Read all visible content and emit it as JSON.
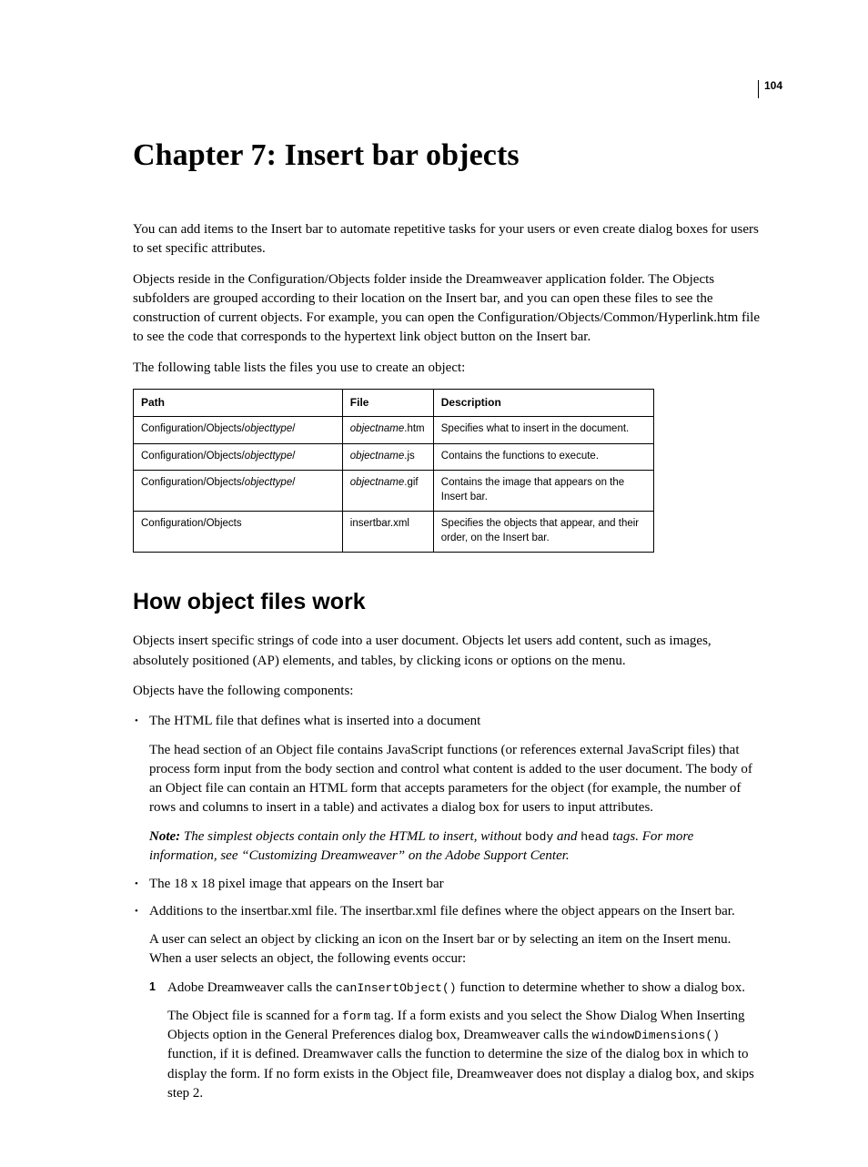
{
  "page_number": "104",
  "chapter_title": "Chapter 7: Insert bar objects",
  "intro_p1": "You can add items to the Insert bar to automate repetitive tasks for your users or even create dialog boxes for users to set specific attributes.",
  "intro_p2": "Objects reside in the Configuration/Objects folder inside the Dreamweaver application folder. The Objects subfolders are grouped according to their location on the Insert bar, and you can open these files to see the construction of current objects. For example, you can open the Configuration/Objects/Common/Hyperlink.htm file to see the code that corresponds to the hypertext link object button on the Insert bar.",
  "intro_p3": "The following table lists the files you use to create an object:",
  "table": {
    "headers": {
      "path": "Path",
      "file": "File",
      "desc": "Description"
    },
    "rows": [
      {
        "path_pre": "Configuration/Objects/",
        "path_it": "objecttype",
        "path_post": "/",
        "file_it": "objectname",
        "file_post": ".htm",
        "desc": "Specifies what to insert in the document."
      },
      {
        "path_pre": "Configuration/Objects/",
        "path_it": "objecttype",
        "path_post": "/",
        "file_it": "objectname",
        "file_post": ".js",
        "desc": "Contains the functions to execute."
      },
      {
        "path_pre": "Configuration/Objects/",
        "path_it": "objecttype",
        "path_post": "/",
        "file_it": "objectname",
        "file_post": ".gif",
        "desc": "Contains the image that appears on the Insert bar."
      },
      {
        "path_pre": "Configuration/Objects",
        "path_it": "",
        "path_post": "",
        "file_it": "",
        "file_post": "insertbar.xml",
        "desc": "Specifies the objects that appear, and their order, on the Insert bar."
      }
    ]
  },
  "section2": {
    "title": "How object files work",
    "p1": "Objects insert specific strings of code into a user document. Objects let users add content, such as images, absolutely positioned (AP) elements, and tables, by clicking icons or options on the menu.",
    "p2": "Objects have the following components:",
    "bullet1": "The HTML file that defines what is inserted into a document",
    "bullet1_sub": "The head section of an Object file contains JavaScript functions (or references external JavaScript files) that process form input from the body section and control what content is added to the user document. The body of an Object file can contain an HTML form that accepts parameters for the object (for example, the number of rows and columns to insert in a table) and activates a dialog box for users to input attributes.",
    "note_label": "Note: ",
    "note_pre": "The simplest objects contain only the HTML to insert, without ",
    "note_code1": "body",
    "note_mid": " and ",
    "note_code2": "head",
    "note_post": " tags. For more information, see “Customizing Dreamweaver” on the Adobe Support Center.",
    "bullet2": "The 18 x 18 pixel image that appears on the Insert bar",
    "bullet3": "Additions to the insertbar.xml file. The insertbar.xml file defines where the object appears on the Insert bar.",
    "bullet3_sub": "A user can select an object by clicking an icon on the Insert bar or by selecting an item on the Insert menu. When a user selects an object, the following events occur:",
    "step1_pre": "Adobe Dreamweaver calls the ",
    "step1_code": "canInsertObject()",
    "step1_post": " function to determine whether to show a dialog box.",
    "step1_sub_pre": "The Object file is scanned for a ",
    "step1_sub_code1": "form",
    "step1_sub_mid1": " tag. If a form exists and you select the Show Dialog When Inserting Objects option in the General Preferences dialog box, Dreamweaver calls the ",
    "step1_sub_code2": "windowDimensions()",
    "step1_sub_post": " function, if it is defined. Dreamwaver calls the function to determine the size of the dialog box in which to display the form. If no form exists in the Object file, Dreamweaver does not display a dialog box, and skips step 2."
  }
}
